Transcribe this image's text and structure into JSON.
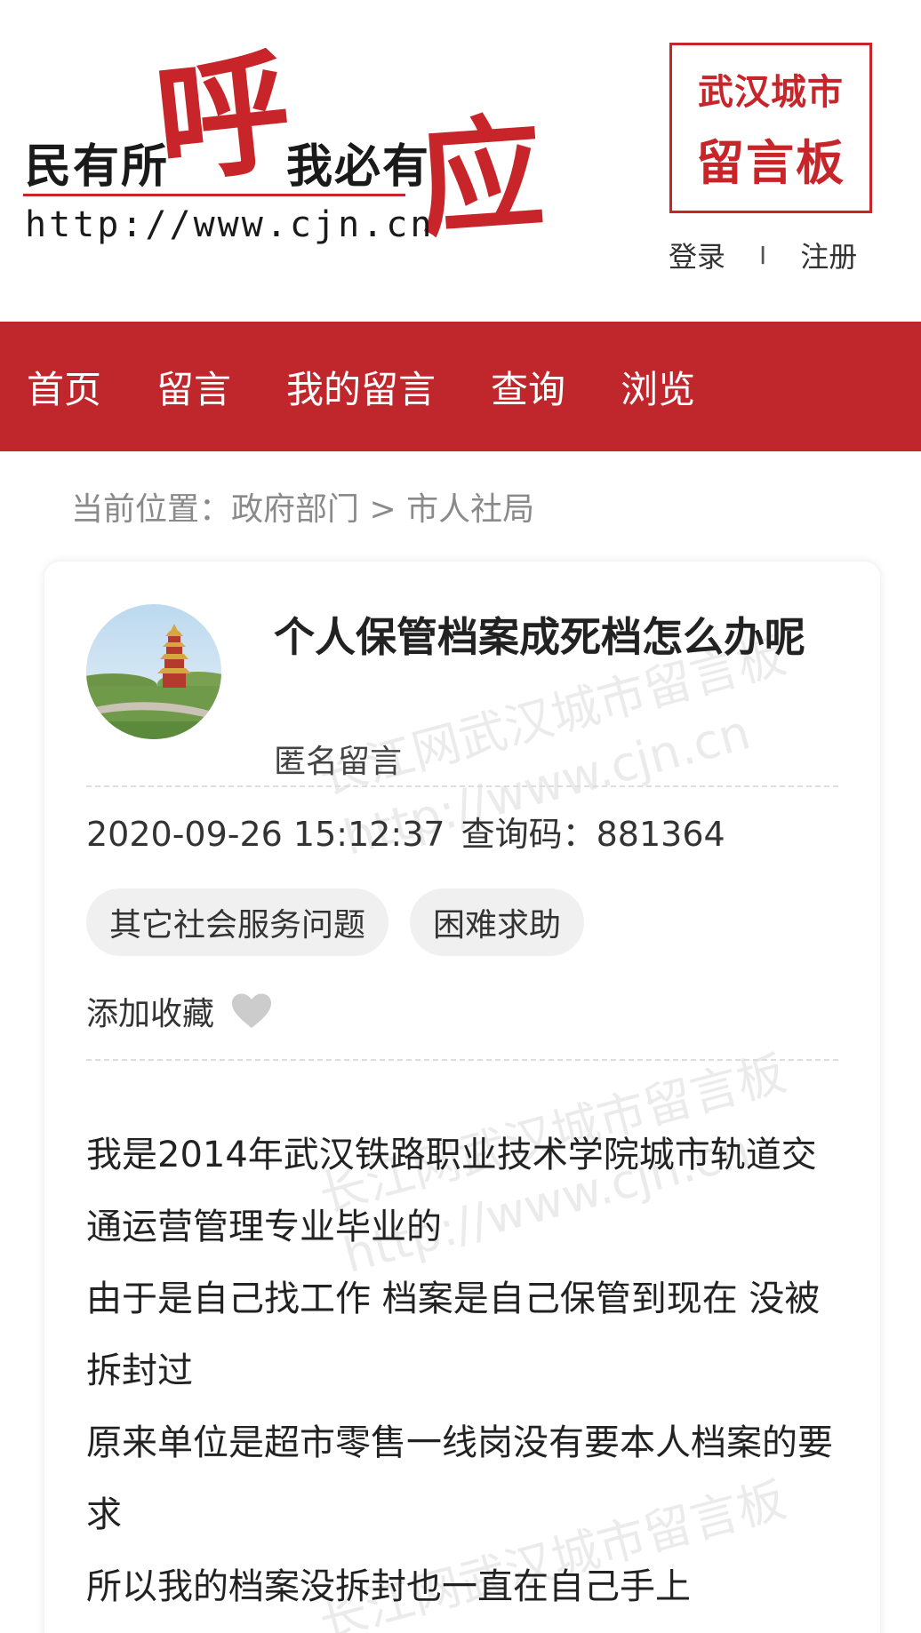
{
  "header": {
    "logo_text_1": "民有所",
    "logo_hu": "呼",
    "logo_text_2": "我必有",
    "logo_ying": "应",
    "logo_url": "http://www.cjn.cn",
    "seal_line1": "武汉城市",
    "seal_line2": "留言板",
    "login": "登录",
    "separator": "I",
    "register": "注册"
  },
  "nav": {
    "items": [
      "首页",
      "留言",
      "我的留言",
      "查询",
      "浏览"
    ]
  },
  "breadcrumb": {
    "label": "当前位置：",
    "path": "政府部门 > 市人社局"
  },
  "post": {
    "title": "个人保管档案成死档怎么办呢",
    "author": "匿名留言",
    "datetime": "2020-09-26 15:12:37",
    "code_label": "查询码：",
    "code": "881364",
    "tags": [
      "其它社会服务问题",
      "困难求助"
    ],
    "favorite_label": "添加收藏",
    "watermark_1": "长江网武汉城市留言板",
    "watermark_2": "http://www.cjn.cn",
    "content": [
      "我是2014年武汉铁路职业技术学院城市轨道交通运营管理专业毕业的",
      "由于是自己找工作 档案是自己保管到现在 没被拆封过",
      "原来单位是超市零售一线岗没有要本人档案的要求",
      "所以我的档案没拆封也一直在自己手上"
    ]
  },
  "colors": {
    "brand_red": "#c0272d",
    "tag_bg": "#f0f0f0",
    "heart": "#cccccc"
  }
}
